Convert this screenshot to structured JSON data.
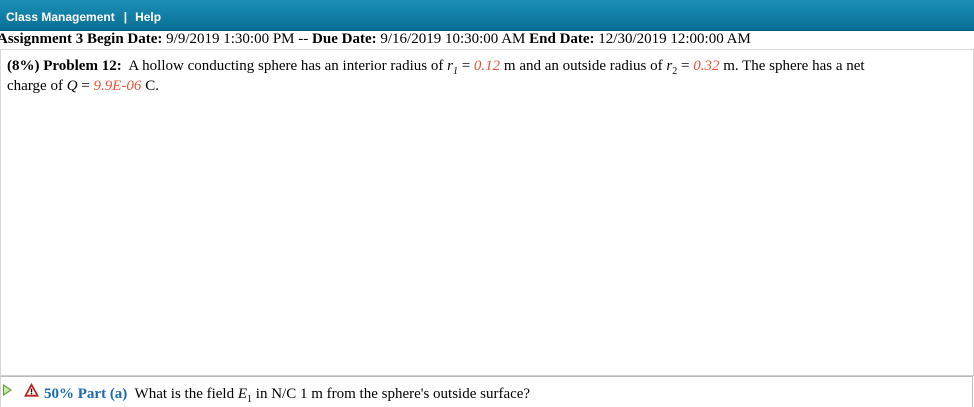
{
  "nav": {
    "class_management": "Class Management",
    "separator": "|",
    "help": "Help"
  },
  "assignment": {
    "title_label": "Assignment 3 Begin Date:",
    "begin_date": "9/9/2019 1:30:00 PM",
    "dash": "--",
    "due_label": "Due Date:",
    "due_date": "9/16/2019 10:30:00 AM",
    "end_label": "End Date:",
    "end_date": "12/30/2019 12:00:00 AM"
  },
  "problem": {
    "weight": "(8%)",
    "number_label": "Problem 12:",
    "text1": "A hollow conducting sphere has an interior radius of",
    "r1_symbol": "r",
    "r1_sub": "1",
    "eq": "=",
    "r1_value": "0.12",
    "unit_m": "m",
    "text2": "and an outside radius of",
    "r2_symbol": "r",
    "r2_sub": "2",
    "r2_value": "0.32",
    "text3": "m. The sphere has a net charge of",
    "q_symbol": "Q",
    "q_value": "9.9E-06",
    "unit_c": "C."
  },
  "part_a": {
    "percent": "50% Part (a)",
    "q1": "What is the field",
    "e_symbol": "E",
    "e_sub": "1",
    "q2": "in N/C 1 m from the sphere's outside surface?"
  },
  "colors": {
    "header_bg": "#1282ab",
    "given_value": "#e8543a",
    "part_label": "#1b6ab3"
  }
}
